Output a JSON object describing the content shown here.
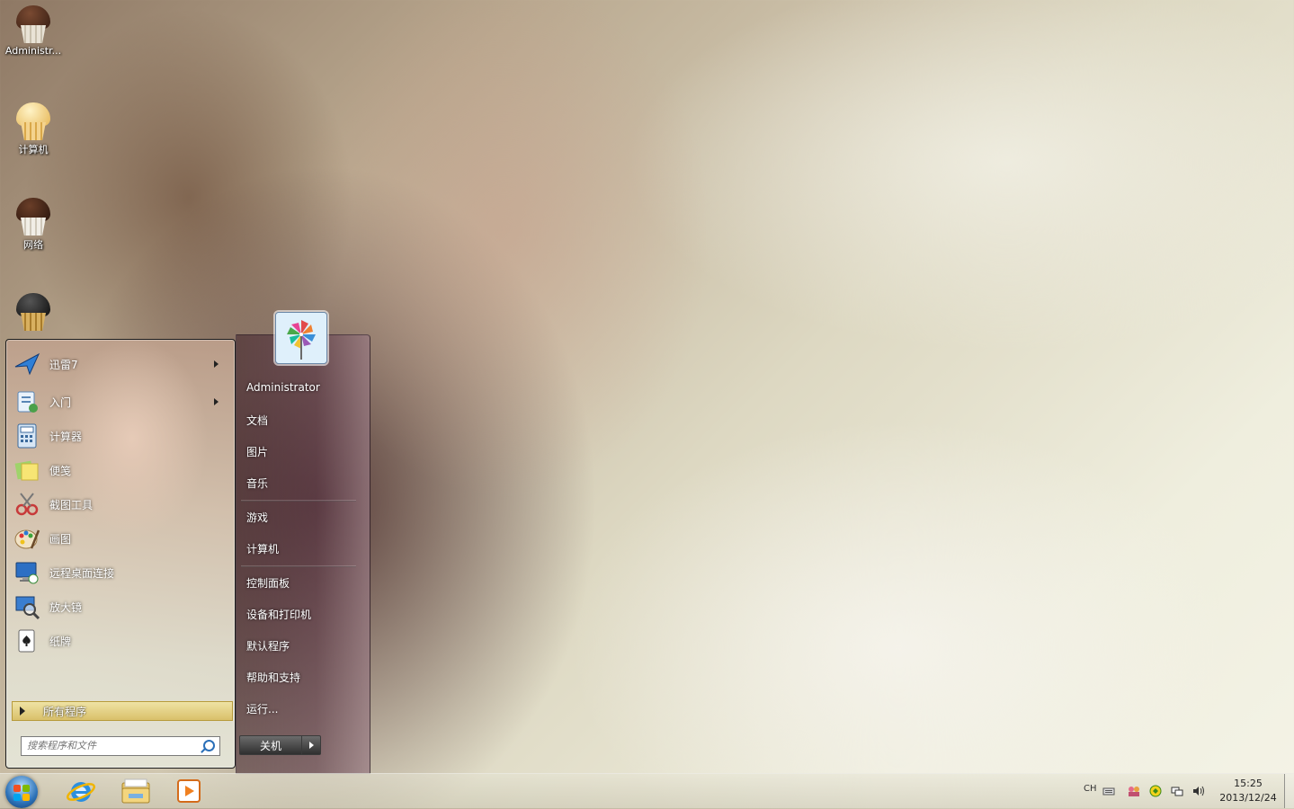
{
  "desktop": {
    "icons": [
      {
        "label": "Administr...",
        "icon": "chocolate-cupcake-icon"
      },
      {
        "label": "计算机",
        "icon": "vanilla-cupcake-icon"
      },
      {
        "label": "网络",
        "icon": "chocolate-cupcake-icon"
      },
      {
        "label": "",
        "icon": "recycle-bin-cupcake-icon"
      }
    ]
  },
  "start_menu": {
    "programs": [
      {
        "label": "迅雷7",
        "icon": "xunlei-icon",
        "has_submenu": true
      },
      {
        "label": "入门",
        "icon": "getting-started-icon",
        "has_submenu": true
      },
      {
        "label": "计算器",
        "icon": "calculator-icon",
        "has_submenu": false
      },
      {
        "label": "便笺",
        "icon": "sticky-notes-icon",
        "has_submenu": false
      },
      {
        "label": "截图工具",
        "icon": "snipping-tool-icon",
        "has_submenu": false
      },
      {
        "label": "画图",
        "icon": "paint-icon",
        "has_submenu": false
      },
      {
        "label": "远程桌面连接",
        "icon": "remote-desktop-icon",
        "has_submenu": false
      },
      {
        "label": "放大镜",
        "icon": "magnifier-icon",
        "has_submenu": false
      },
      {
        "label": "纸牌",
        "icon": "solitaire-icon",
        "has_submenu": false
      }
    ],
    "all_programs": "所有程序",
    "search_placeholder": "搜索程序和文件",
    "right_links": [
      "Administrator",
      "文档",
      "图片",
      "音乐",
      "游戏",
      "计算机",
      "控制面板",
      "设备和打印机",
      "默认程序",
      "帮助和支持",
      "运行..."
    ],
    "shutdown_label": "关机"
  },
  "taskbar": {
    "pinned": [
      "internet-explorer-icon",
      "windows-explorer-icon",
      "media-player-icon"
    ],
    "tray": {
      "language": "CH"
    },
    "clock": {
      "time": "15:25",
      "date": "2013/12/24"
    }
  },
  "colors": {
    "all_programs_highlight": "#e3cf7e",
    "start_orb": "#2d72b8"
  }
}
